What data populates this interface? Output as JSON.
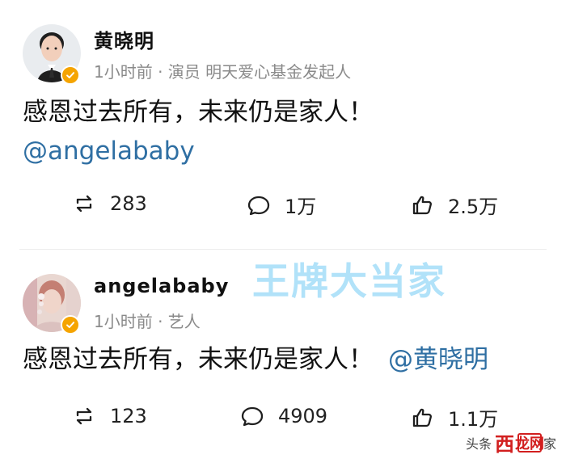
{
  "posts": [
    {
      "username": "黄晓明",
      "meta": "1小时前 · 演员 明天爱心基金发起人",
      "content": "感恩过去所有，未来仍是家人！",
      "mention": "@angelababy",
      "actions": {
        "repost": "283",
        "comment": "1万",
        "like": "2.5万"
      }
    },
    {
      "username": "angelababy",
      "meta": "1小时前 · 艺人",
      "content": "感恩过去所有，未来仍是家人！",
      "mention": "@黄晓明",
      "actions": {
        "repost": "123",
        "comment": "4909",
        "like": "1.1万"
      }
    }
  ],
  "watermark": "王牌大当家",
  "footer": {
    "prefix": "头条",
    "brand_mid": "西",
    "brand_box": "龙网",
    "suffix": "家"
  },
  "colors": {
    "mention": "#2f6fa3",
    "meta": "#8a8a8a",
    "badge": "#f5a400",
    "watermark": "#78cdf5",
    "footer_accent": "#d21f1f"
  },
  "icons": {
    "repost": "repost-icon",
    "comment": "comment-icon",
    "like": "like-icon",
    "verified": "verified-icon"
  }
}
